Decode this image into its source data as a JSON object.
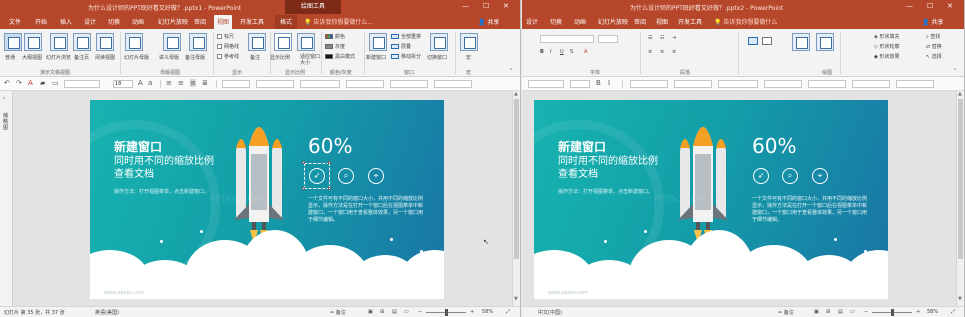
{
  "left_window": {
    "title": "为什么设计师的PPT既好看又好做？.pptx1  -  PowerPoint",
    "context_band": "绘图工具",
    "tabs": [
      "文件",
      "开始",
      "插入",
      "设计",
      "切换",
      "动画",
      "幻灯片放映",
      "审阅",
      "视图",
      "开发工具",
      "格式"
    ],
    "active_tab": "视图",
    "tell_me": "告诉我你想要做什么...",
    "share": "共享",
    "ribbon": {
      "view_buttons": [
        "普通",
        "大纲视图",
        "幻灯片浏览",
        "备注页",
        "阅读视图",
        "幻灯片母版",
        "讲义母版",
        "备注母版"
      ],
      "show_checks": [
        "标尺",
        "网格线",
        "参考线"
      ],
      "show_buttons": [
        "备注"
      ],
      "zoom_buttons": [
        "显示比例",
        "适应窗口大小"
      ],
      "color_items": [
        "颜色",
        "灰度",
        "黑白模式"
      ],
      "window_buttons": [
        "新建窗口"
      ],
      "window_items": [
        "全部重排",
        "层叠",
        "移动拆分"
      ],
      "switch_window": "切换窗口",
      "macro": "宏",
      "groups": [
        "演示文稿视图",
        "母版视图",
        "显示",
        "显示比例",
        "颜色/灰度",
        "窗口",
        "宏"
      ]
    },
    "font_size": "18",
    "thumb_label": "缩略图",
    "status": {
      "slide_info": "幻灯片 第 35 张，共 37 张",
      "lang": "英语(美国)",
      "notes": "备注",
      "zoom": "58%"
    }
  },
  "right_window": {
    "title": "为什么设计师的PPT既好看又好做？.pptx2  -  PowerPoint",
    "tabs": [
      "设计",
      "切换",
      "动画",
      "幻灯片放映",
      "审阅",
      "视图",
      "开发工具"
    ],
    "tell_me": "告诉我你想要做什么",
    "share": "共享",
    "ribbon": {
      "groups": [
        "字体",
        "段落",
        "绘图"
      ],
      "right_items": [
        "形状填充",
        "形状轮廓",
        "形状效果",
        "查找",
        "替换",
        "选择"
      ]
    },
    "status": {
      "lang": "中文(中国)",
      "notes": "备注",
      "zoom": "58%"
    }
  },
  "slide": {
    "heading": "新建窗口",
    "subheading_line1": "同时用不同的缩放比例",
    "subheading_line2": "查看文档",
    "caption": "操作方法：打开视图菜单，点击新建窗口。",
    "percent": "60%",
    "icons": [
      "rocket-icon",
      "search-icon",
      "location-pin-icon"
    ],
    "body": "一个文件可有不同的窗口大小，并用不同的缩放比例显示，操作方法是在打开一个窗口后在视图菜单中新建窗口，一个窗口用于查看整体效果，另一个窗口用于细节编辑。",
    "watermark": "PPTAO.COM",
    "footer": "www.pptao.com",
    "colors": {
      "top": "#18b3b0",
      "bottom": "#1a74a6",
      "accent": "#f5a023",
      "title_bar": "#b7472a"
    }
  }
}
